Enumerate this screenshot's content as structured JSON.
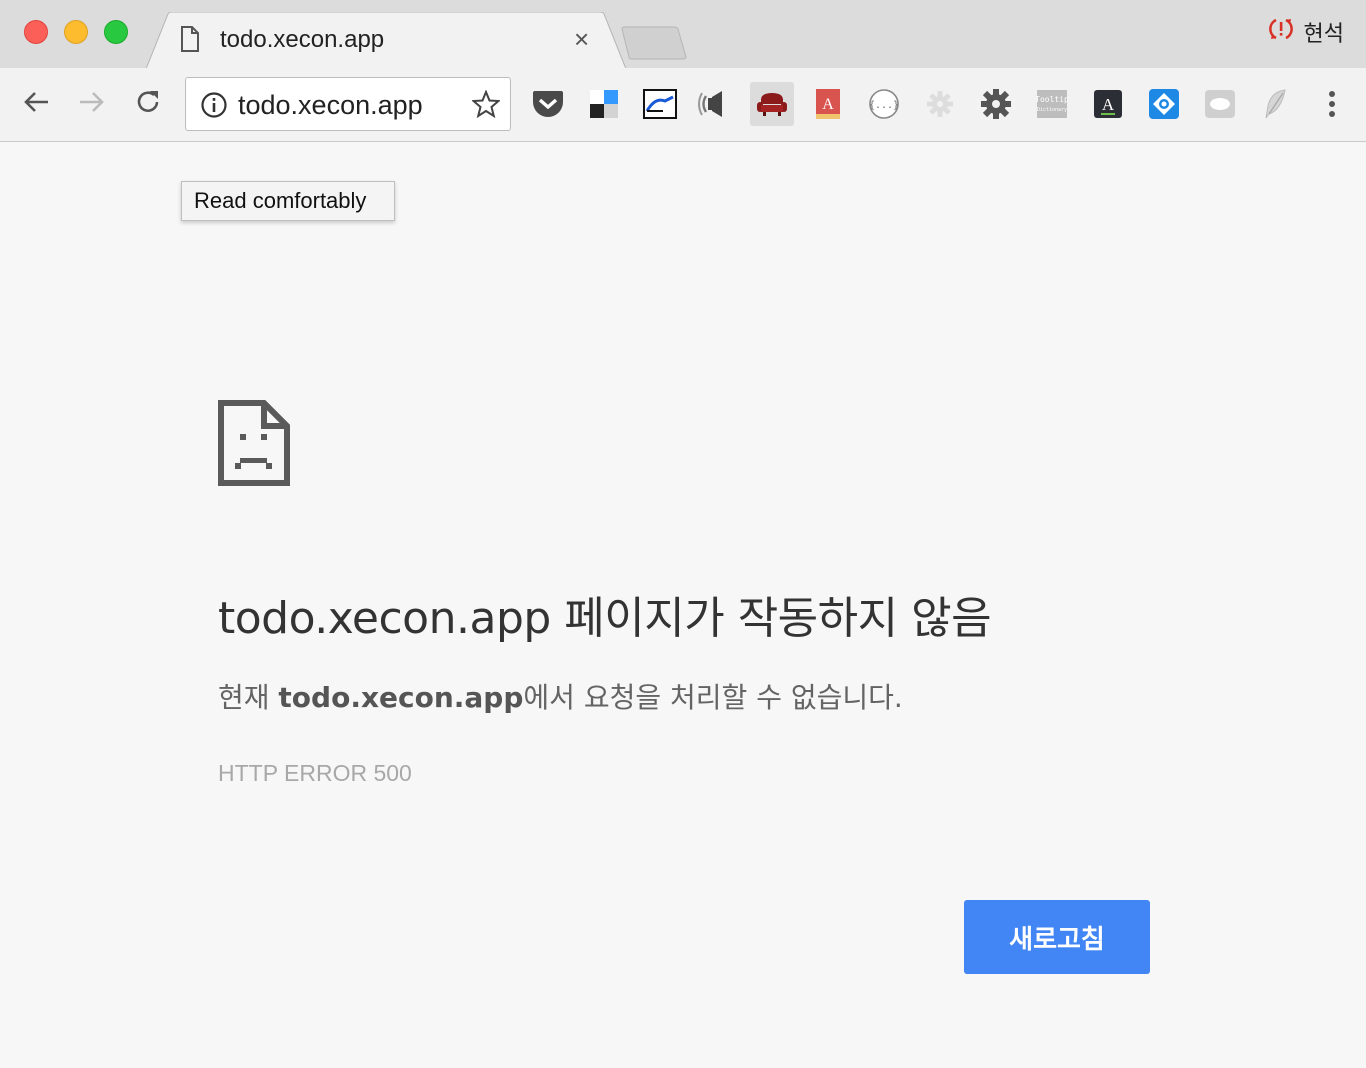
{
  "window": {
    "tab_title": "todo.xecon.app",
    "tab_close": "×",
    "profile_name": "현석",
    "sync_icon": "sync-error-icon"
  },
  "toolbar": {
    "url": "todo.xecon.app",
    "icons": [
      "back-arrow-icon",
      "forward-arrow-icon",
      "reload-icon",
      "site-info-icon",
      "bookmark-star-icon",
      "menu-dots-icon"
    ],
    "extensions": [
      "pocket-extension-icon",
      "delicious-extension-icon",
      "image-extension-icon",
      "speaker-extension-icon",
      "read-comfortably-extension-icon",
      "dictionary-book-extension-icon",
      "json-formatter-extension-icon",
      "gear-extension-icon",
      "dark-gear-extension-icon",
      "tooltip-dictionary-extension-icon",
      "font-extension-icon",
      "blue-diamond-extension-icon",
      "cloud-extension-icon",
      "feather-extension-icon"
    ]
  },
  "tooltip": {
    "text": "Read comfortably"
  },
  "error": {
    "icon": "sad-page-icon",
    "title": "todo.xecon.app 페이지가 작동하지 않음",
    "desc_prefix": "현재 ",
    "desc_host": "todo.xecon.app",
    "desc_suffix": "에서 요청을 처리할 수 없습니다.",
    "code": "HTTP ERROR 500",
    "reload_label": "새로고침"
  },
  "colors": {
    "accent": "#4285f4",
    "sync_error": "#d93025",
    "tab_bar": "#dcdcdc",
    "page_bg": "#f7f7f7"
  }
}
